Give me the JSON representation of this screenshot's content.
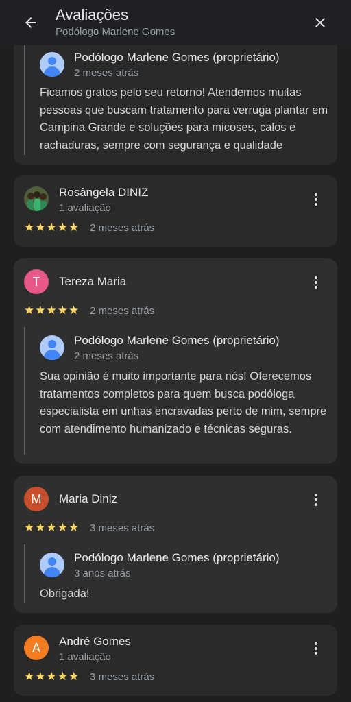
{
  "header": {
    "title": "Avaliações",
    "subtitle": "Podólogo Marlene Gomes",
    "back_icon": "arrow-back-icon",
    "close_icon": "close-icon"
  },
  "reviews": [
    {
      "reply": {
        "owner": "Podólogo Marlene Gomes (proprietário)",
        "date": "2 meses atrás",
        "text": "Ficamos gratos pelo seu retorno! Atendemos muitas pessoas que buscam tratamento para verruga plantar em Campina Grande e soluções para micoses, calos e rachaduras, sempre com segurança e qualidade"
      }
    },
    {
      "author": "Rosângela DINIZ",
      "author_meta": "1 avaliação",
      "rating": 5,
      "stars": "★★★★★",
      "date": "2 meses atrás"
    },
    {
      "author": "Tereza Maria",
      "initial": "T",
      "avatar_color": "#e8578a",
      "rating": 5,
      "stars": "★★★★★",
      "date": "2 meses atrás",
      "reply": {
        "owner": "Podólogo Marlene Gomes (proprietário)",
        "date": "2 meses atrás",
        "text": "Sua opinião é muito importante para nós! Oferecemos tratamentos completos para quem busca podóloga especialista em unhas encravadas perto de mim, sempre com atendimento humanizado e técnicas seguras."
      }
    },
    {
      "author": "Maria Diniz",
      "initial": "M",
      "avatar_color": "#c84f2b",
      "rating": 5,
      "stars": "★★★★★",
      "date": "3 meses atrás",
      "reply": {
        "owner": "Podólogo Marlene Gomes (proprietário)",
        "date": "3 anos atrás",
        "text": "Obrigada!"
      }
    },
    {
      "author": "André Gomes",
      "initial": "A",
      "avatar_color": "#f47c20",
      "author_meta": "1 avaliação",
      "rating": 5,
      "stars": "★★★★★",
      "date": "3 meses atrás"
    }
  ],
  "colors": {
    "background": "#1f1f1f",
    "card": "#2a2a2a",
    "star": "#fdd663",
    "owner_avatar": "#aecbfa"
  }
}
